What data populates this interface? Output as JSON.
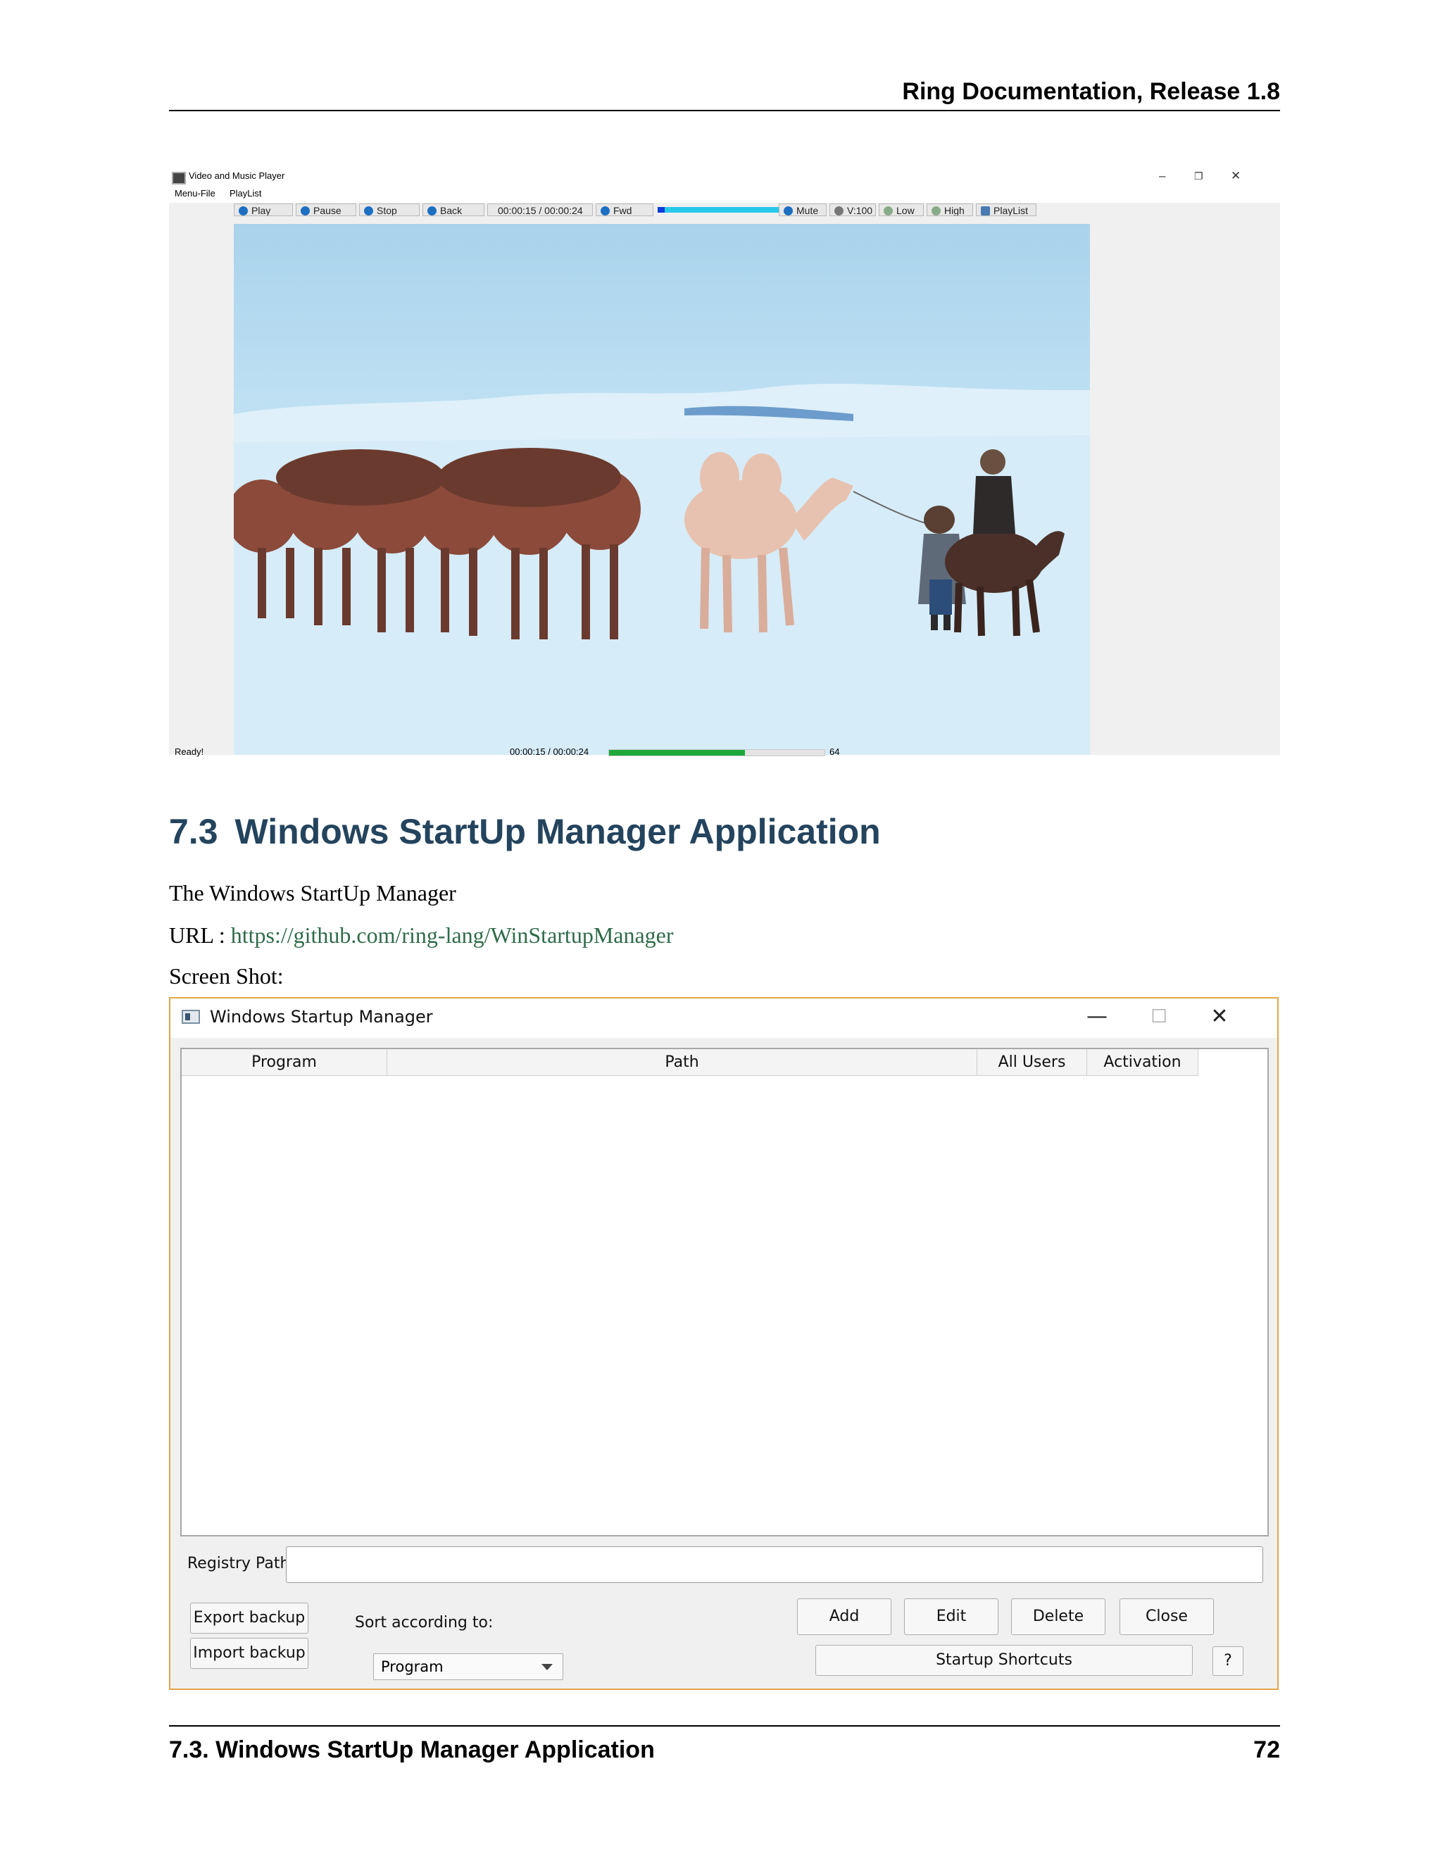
{
  "header": {
    "running_title": "Ring Documentation, Release 1.8"
  },
  "video_player": {
    "window_title": "Video and Music Player",
    "window_controls": [
      "–",
      "❐",
      "✕"
    ],
    "menu": [
      "Menu-File",
      "PlayList"
    ],
    "toolbar": {
      "play": "Play",
      "pause": "Pause",
      "stop": "Stop",
      "back": "Back",
      "time": "00:00:15 / 00:00:24",
      "fwd": "Fwd",
      "mute": "Mute",
      "volume": "V:100",
      "low": "Low",
      "high": "High",
      "playlist": "PlayList"
    },
    "status": "Ready!",
    "status_time": "00:00:15 / 00:00:24",
    "progress_fraction": 0.63,
    "progress_value": "64"
  },
  "section": {
    "number": "7.3",
    "title": "Windows StartUp Manager Application",
    "intro": "The Windows StartUp Manager",
    "url_label": "URL :",
    "url": "https://github.com/ring-lang/WinStartupManager",
    "screenshot_label": "Screen Shot:"
  },
  "startup_manager": {
    "window_title": "Windows Startup Manager",
    "window_controls": [
      "—",
      "☐",
      "✕"
    ],
    "columns": [
      "Program",
      "Path",
      "All Users",
      "Activation"
    ],
    "registry_label": "Registry Path",
    "registry_value": "",
    "export_backup": "Export backup",
    "import_backup": "Import backup",
    "sort_label": "Sort according to:",
    "sort_value": "Program",
    "add": "Add",
    "edit": "Edit",
    "delete": "Delete",
    "close": "Close",
    "startup_shortcuts": "Startup Shortcuts",
    "help": "?"
  },
  "footer": {
    "section": "7.3.  Windows StartUp Manager Application",
    "page": "72"
  }
}
